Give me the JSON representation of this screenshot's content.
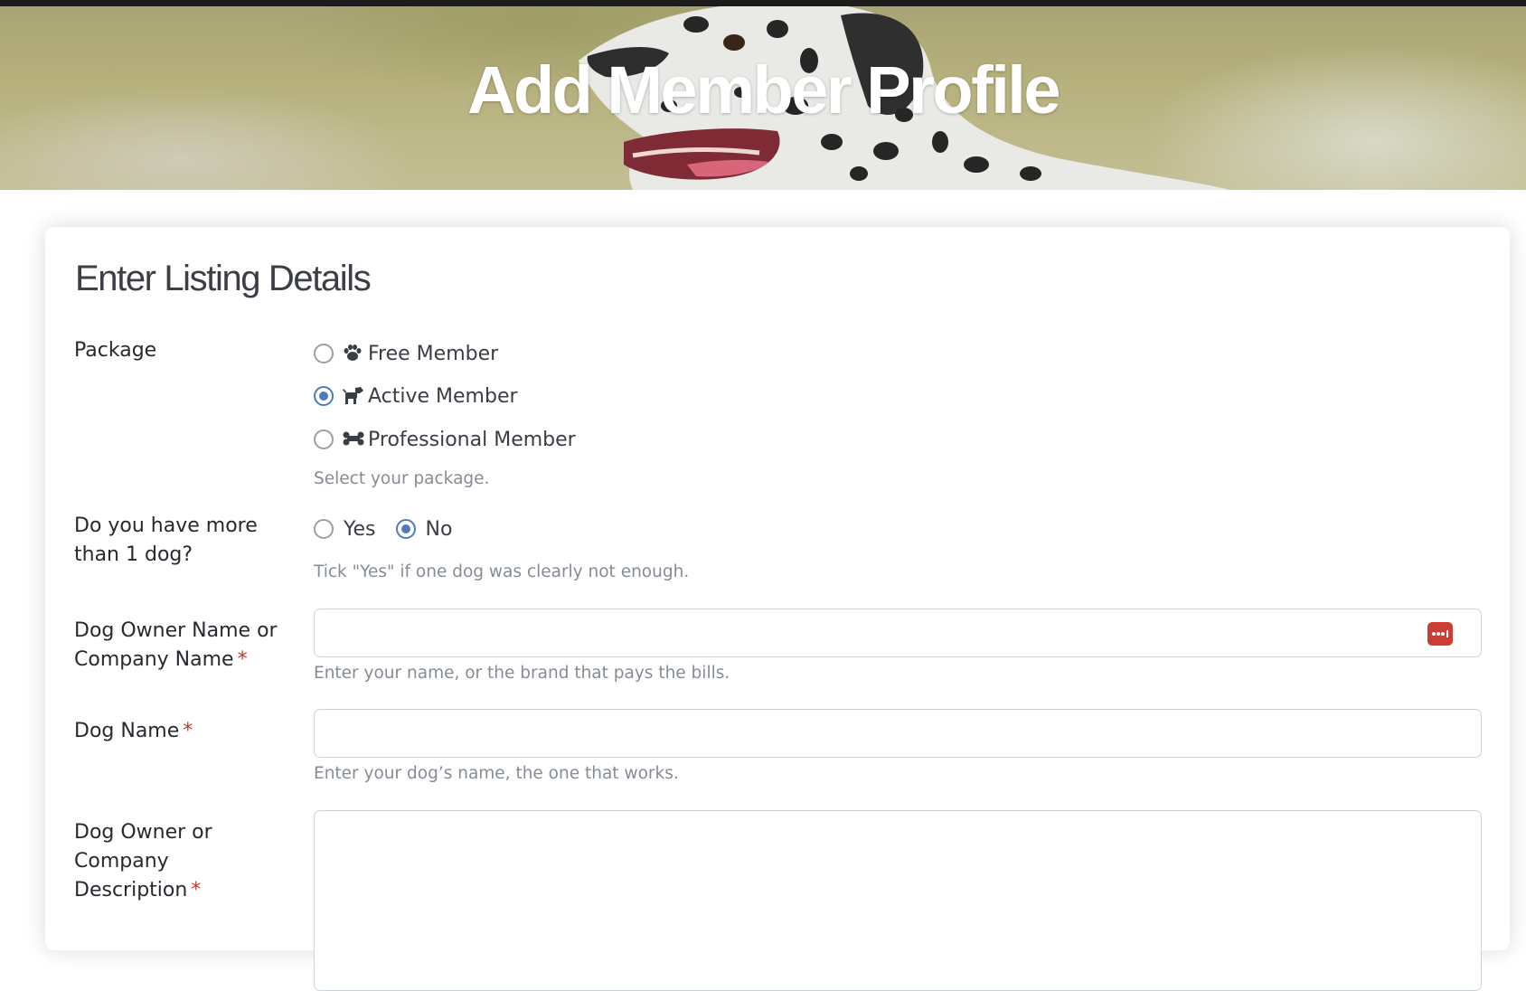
{
  "hero": {
    "title": "Add Member Profile"
  },
  "form": {
    "section_title": "Enter Listing Details",
    "package": {
      "label": "Package",
      "options": [
        {
          "label": "Free Member",
          "icon": "paw-icon",
          "selected": false
        },
        {
          "label": "Active Member",
          "icon": "dog-icon",
          "selected": true
        },
        {
          "label": "Professional Member",
          "icon": "bone-icon",
          "selected": false
        }
      ],
      "help": "Select your package."
    },
    "more_dogs": {
      "label": "Do you have more than 1 dog?",
      "options": [
        {
          "label": "Yes",
          "selected": false
        },
        {
          "label": "No",
          "selected": true
        }
      ],
      "help": "Tick \"Yes\" if one dog was clearly not enough."
    },
    "owner_name": {
      "label": "Dog Owner Name or Company Name",
      "required_mark": "*",
      "value": "",
      "help": "Enter your name, or the brand that pays the bills."
    },
    "dog_name": {
      "label": "Dog Name",
      "required_mark": "*",
      "value": "",
      "help": "Enter your dog’s name, the one that works."
    },
    "description": {
      "label": "Dog Owner or Company Description",
      "required_mark": "*",
      "value": ""
    }
  },
  "colors": {
    "accent": "#4f7bbd",
    "required": "#c0392b",
    "password_manager_icon": "#cc3d33"
  }
}
